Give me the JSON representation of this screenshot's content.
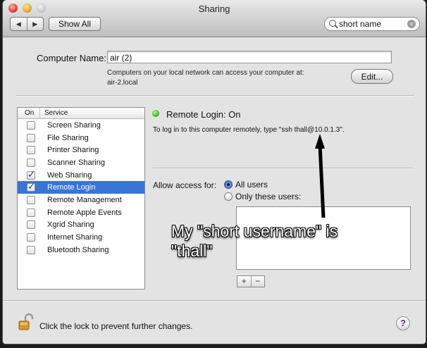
{
  "window": {
    "title": "Sharing"
  },
  "toolbar": {
    "back_glyph": "◀",
    "forward_glyph": "▶",
    "show_all_label": "Show All",
    "search_value": "short name",
    "clear_glyph": "×"
  },
  "computer_name": {
    "label": "Computer Name:",
    "value": "air (2)",
    "note_line1": "Computers on your local network can access your computer at:",
    "note_line2": "air-2.local",
    "edit_label": "Edit..."
  },
  "services": {
    "header_on": "On",
    "header_service": "Service",
    "items": [
      {
        "label": "Screen Sharing",
        "checked": false,
        "selected": false
      },
      {
        "label": "File Sharing",
        "checked": false,
        "selected": false
      },
      {
        "label": "Printer Sharing",
        "checked": false,
        "selected": false
      },
      {
        "label": "Scanner Sharing",
        "checked": false,
        "selected": false
      },
      {
        "label": "Web Sharing",
        "checked": true,
        "selected": false
      },
      {
        "label": "Remote Login",
        "checked": true,
        "selected": true
      },
      {
        "label": "Remote Management",
        "checked": false,
        "selected": false
      },
      {
        "label": "Remote Apple Events",
        "checked": false,
        "selected": false
      },
      {
        "label": "Xgrid Sharing",
        "checked": false,
        "selected": false
      },
      {
        "label": "Internet Sharing",
        "checked": false,
        "selected": false
      },
      {
        "label": "Bluetooth Sharing",
        "checked": false,
        "selected": false
      }
    ]
  },
  "detail": {
    "status": "Remote Login: On",
    "status_color": "#35b816",
    "instructions": "To log in to this computer remotely, type \"ssh thall@10.0.1.3\".",
    "allow_label": "Allow access for:",
    "option_all": "All users",
    "option_these": "Only these users:",
    "add_glyph": "+",
    "remove_glyph": "−"
  },
  "footer": {
    "lock_text": "Click the lock to prevent further changes.",
    "help_glyph": "?"
  },
  "annotation": {
    "line1": "My \"short username\" is",
    "line2": "\"thall\""
  },
  "colors": {
    "selection": "#3875d7",
    "window_bg": "#e3e3e3"
  }
}
